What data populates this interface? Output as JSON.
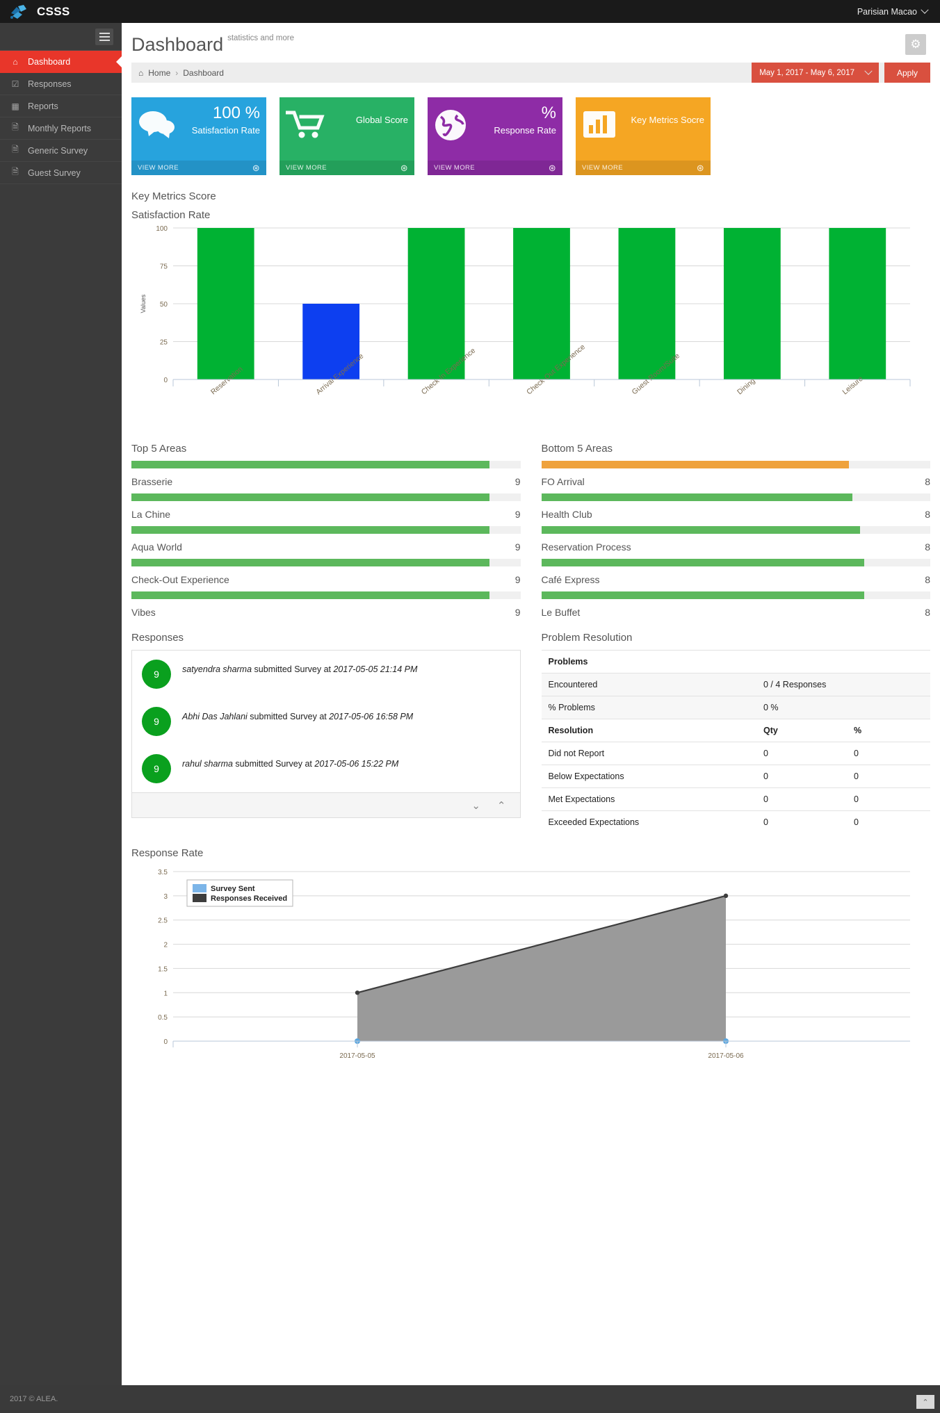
{
  "topbar": {
    "brand": "CSSS",
    "user": "Parisian Macao",
    "caret_icon": "chevron-down-icon"
  },
  "sidebar": {
    "items": [
      {
        "label": "Dashboard",
        "icon": "home-icon",
        "active": true
      },
      {
        "label": "Responses",
        "icon": "check-square-icon",
        "active": false
      },
      {
        "label": "Reports",
        "icon": "table-icon",
        "active": false
      },
      {
        "label": "Monthly Reports",
        "icon": "file-icon",
        "active": false
      },
      {
        "label": "Generic Survey",
        "icon": "file-icon",
        "active": false
      },
      {
        "label": "Guest Survey",
        "icon": "file-icon",
        "active": false
      }
    ]
  },
  "header": {
    "title": "Dashboard",
    "subtitle": "statistics and more",
    "gear_icon": "gear-icon"
  },
  "breadcrumb": {
    "home": "Home",
    "separator": "›",
    "current": "Dashboard",
    "home_icon": "home-icon"
  },
  "daterange": {
    "value": "May 1, 2017 - May 6, 2017",
    "caret_icon": "chevron-down-icon",
    "apply_label": "Apply"
  },
  "cards": [
    {
      "value": "100 %",
      "label": "Satisfaction Rate",
      "color": "#27a3dd",
      "glyph": "💬",
      "icon": "comments-icon",
      "foot": "VIEW MORE",
      "arrow": "→"
    },
    {
      "value": "",
      "label": "Global Score",
      "color": "#28b165",
      "glyph": "🛒",
      "icon": "shopping-cart-icon",
      "foot": "VIEW MORE",
      "arrow": "→"
    },
    {
      "value": "%",
      "label": "Response Rate",
      "color": "#8e2ca6",
      "glyph": "🌍",
      "icon": "globe-icon",
      "foot": "VIEW MORE",
      "arrow": "→"
    },
    {
      "value": "",
      "label": "Key Metrics Socre",
      "color": "#f5a623",
      "glyph": "📊",
      "icon": "bar-chart-icon",
      "foot": "VIEW MORE",
      "arrow": "→"
    }
  ],
  "key_metrics": {
    "section_title": "Key Metrics Score",
    "chart_title": "Satisfaction Rate"
  },
  "top_areas": {
    "title": "Top 5 Areas",
    "rows": [
      {
        "label": "Brasserie",
        "value": "9",
        "pct": 92,
        "color": "#5cb85c"
      },
      {
        "label": "La Chine",
        "value": "9",
        "pct": 92,
        "color": "#5cb85c"
      },
      {
        "label": "Aqua World",
        "value": "9",
        "pct": 92,
        "color": "#5cb85c"
      },
      {
        "label": "Check-Out Experience",
        "value": "9",
        "pct": 92,
        "color": "#5cb85c"
      },
      {
        "label": "Vibes",
        "value": "9",
        "pct": 92,
        "color": "#5cb85c"
      }
    ]
  },
  "bottom_areas": {
    "title": "Bottom 5 Areas",
    "rows": [
      {
        "label": "FO Arrival",
        "value": "8",
        "pct": 79,
        "color": "#efa23c"
      },
      {
        "label": "Health Club",
        "value": "8",
        "pct": 80,
        "color": "#5cb85c"
      },
      {
        "label": "Reservation Process",
        "value": "8",
        "pct": 82,
        "color": "#5cb85c"
      },
      {
        "label": "Café Express",
        "value": "8",
        "pct": 83,
        "color": "#5cb85c"
      },
      {
        "label": "Le Buffet",
        "value": "8",
        "pct": 83,
        "color": "#5cb85c"
      }
    ]
  },
  "responses": {
    "title": "Responses",
    "items": [
      {
        "score": "9",
        "user": "satyendra sharma",
        "action": "submitted Survey at",
        "time": "2017-05-05 21:14 PM"
      },
      {
        "score": "9",
        "user": "Abhi Das Jahlani",
        "action": "submitted Survey at",
        "time": "2017-05-06 16:58 PM"
      },
      {
        "score": "9",
        "user": "rahul sharma",
        "action": "submitted Survey at",
        "time": "2017-05-06 15:22 PM"
      }
    ],
    "down_icon": "chevron-down-icon",
    "up_icon": "chevron-up-icon"
  },
  "problem_resolution": {
    "title": "Problem Resolution",
    "problems_header": "Problems",
    "problem_rows": [
      {
        "label": "Encountered",
        "value": "0 / 4 Responses"
      },
      {
        "label": "% Problems",
        "value": "0 %"
      }
    ],
    "resolution_header": "Resolution",
    "qty_header": "Qty",
    "pct_header": "%",
    "resolution_rows": [
      {
        "label": "Did not Report",
        "qty": "0",
        "pct": "0"
      },
      {
        "label": "Below Expectations",
        "qty": "0",
        "pct": "0"
      },
      {
        "label": "Met Expectations",
        "qty": "0",
        "pct": "0"
      },
      {
        "label": "Exceeded Expectations",
        "qty": "0",
        "pct": "0"
      }
    ]
  },
  "response_rate": {
    "title": "Response Rate"
  },
  "footer": {
    "text": "2017 © ALEA.",
    "scroll_top_icon": "chevron-up-icon"
  },
  "chart_data": [
    {
      "type": "bar",
      "title": "Satisfaction Rate",
      "xlabel": "",
      "ylabel": "Values",
      "ylim": [
        0,
        100
      ],
      "yticks": [
        0,
        25,
        50,
        75,
        100
      ],
      "grid": true,
      "categories": [
        "Reservation",
        "Arrival Experience",
        "Check-In Experience",
        "Check-Out Experience",
        "Guest Room/Suite",
        "Dining",
        "Leisure"
      ],
      "values": [
        100,
        50,
        100,
        100,
        100,
        100,
        100
      ],
      "colors": [
        "#00b233",
        "#0d3ff0",
        "#00b233",
        "#00b233",
        "#00b233",
        "#00b233",
        "#00b233"
      ]
    },
    {
      "type": "area",
      "title": "Response Rate",
      "xlabel": "",
      "ylabel": "",
      "ylim": [
        0,
        3.5
      ],
      "yticks": [
        0,
        0.5,
        1,
        1.5,
        2,
        2.5,
        3,
        3.5
      ],
      "grid": true,
      "legend_position": "top-left",
      "x": [
        "2017-05-05",
        "2017-05-06"
      ],
      "series": [
        {
          "name": "Survey Sent",
          "values": [
            0,
            0
          ],
          "color": "#7cb5e8"
        },
        {
          "name": "Responses Received",
          "values": [
            1,
            3
          ],
          "color": "#3d3d3d"
        }
      ]
    }
  ]
}
